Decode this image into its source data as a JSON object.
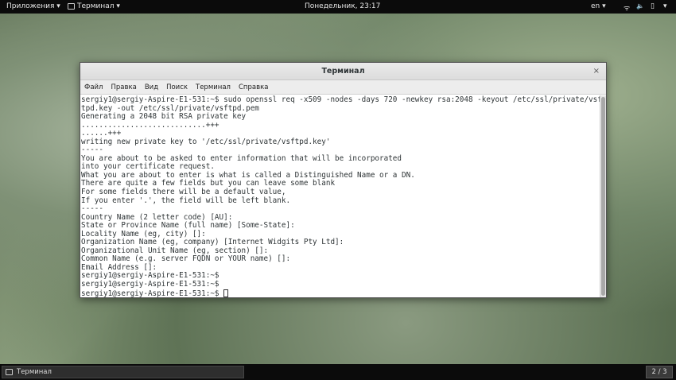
{
  "topbar": {
    "apps": "Приложения ▾",
    "terminal": "Терминал ▾",
    "clock": "Понедельник, 23:17",
    "lang": "en ▾",
    "wifi": "ᯤ",
    "sound": "🔈",
    "battery": "▯",
    "power": "▾"
  },
  "window": {
    "title": "Терминал",
    "close": "×",
    "menu": [
      "Файл",
      "Правка",
      "Вид",
      "Поиск",
      "Терминал",
      "Справка"
    ],
    "lines": [
      "sergiy1@sergiy-Aspire-E1-531:~$ sudo openssl req -x509 -nodes -days 720 -newkey rsa:2048 -keyout /etc/ssl/private/vsf",
      "tpd.key -out /etc/ssl/private/vsftpd.pem",
      "Generating a 2048 bit RSA private key",
      "............................+++",
      "......+++",
      "writing new private key to '/etc/ssl/private/vsftpd.key'",
      "-----",
      "You are about to be asked to enter information that will be incorporated",
      "into your certificate request.",
      "What you are about to enter is what is called a Distinguished Name or a DN.",
      "There are quite a few fields but you can leave some blank",
      "For some fields there will be a default value,",
      "If you enter '.', the field will be left blank.",
      "-----",
      "Country Name (2 letter code) [AU]:",
      "State or Province Name (full name) [Some-State]:",
      "Locality Name (eg, city) []:",
      "Organization Name (eg, company) [Internet Widgits Pty Ltd]:",
      "Organizational Unit Name (eg, section) []:",
      "Common Name (e.g. server FQDN or YOUR name) []:",
      "Email Address []:",
      "sergiy1@sergiy-Aspire-E1-531:~$",
      "sergiy1@sergiy-Aspire-E1-531:~$"
    ],
    "prompt": "sergiy1@sergiy-Aspire-E1-531:~$ "
  },
  "taskbar": {
    "task": "Терминал",
    "workspace": "2 / 3"
  }
}
